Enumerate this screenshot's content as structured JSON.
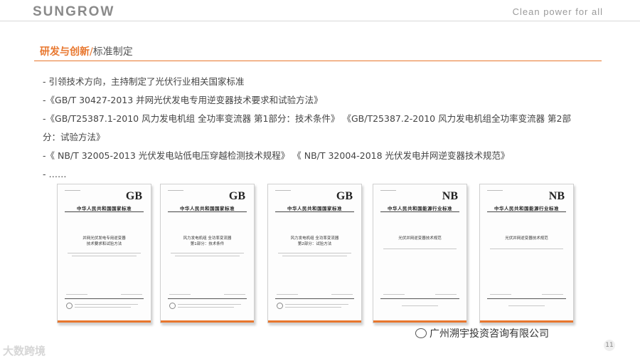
{
  "header": {
    "brand": "SUNGROW",
    "tagline": "Clean power for all"
  },
  "section": {
    "main": "研发与创新",
    "separator": "/",
    "sub": "标准制定"
  },
  "bullets": [
    "- 引领技术方向，主持制定了光伏行业相关国家标准",
    "-《GB/T 30427-2013 并网光伏发电专用逆变器技术要求和试验方法》",
    "-《GB/T25387.1-2010 风力发电机组 全功率变流器 第1部分：技术条件》  《GB/T25387.2-2010 风力发电机组全功率变流器 第2部",
    "分：试验方法》",
    "-《 NB/T 32005-2013  光伏发电站低电压穿越检测技术规程》  《 NB/T 32004-2018 光伏发电并网逆变器技术规范》",
    "- ……"
  ],
  "documents": [
    {
      "mark": "GB",
      "org": "中华人民共和国国家标准",
      "title": "并网光伏发电专用逆变器\n技术要求和试验方法"
    },
    {
      "mark": "GB",
      "org": "中华人民共和国国家标准",
      "title": "风力发电机组  全功率变流器\n第1部分：技术条件"
    },
    {
      "mark": "GB",
      "org": "中华人民共和国国家标准",
      "title": "风力发电机组  全功率变流器\n第2部分：试验方法"
    },
    {
      "mark": "NB",
      "org": "中华人民共和国能源行业标准",
      "title": "光伏并网逆变器技术规范"
    },
    {
      "mark": "NB",
      "org": "中华人民共和国能源行业标准",
      "title": "光伏并网逆变器技术规范"
    }
  ],
  "footer": {
    "wechat": "广州溯宇投资咨询有限公司",
    "page": "11",
    "watermark": "大数跨境"
  },
  "colors": {
    "accent": "#e8772e",
    "text": "#444444"
  }
}
